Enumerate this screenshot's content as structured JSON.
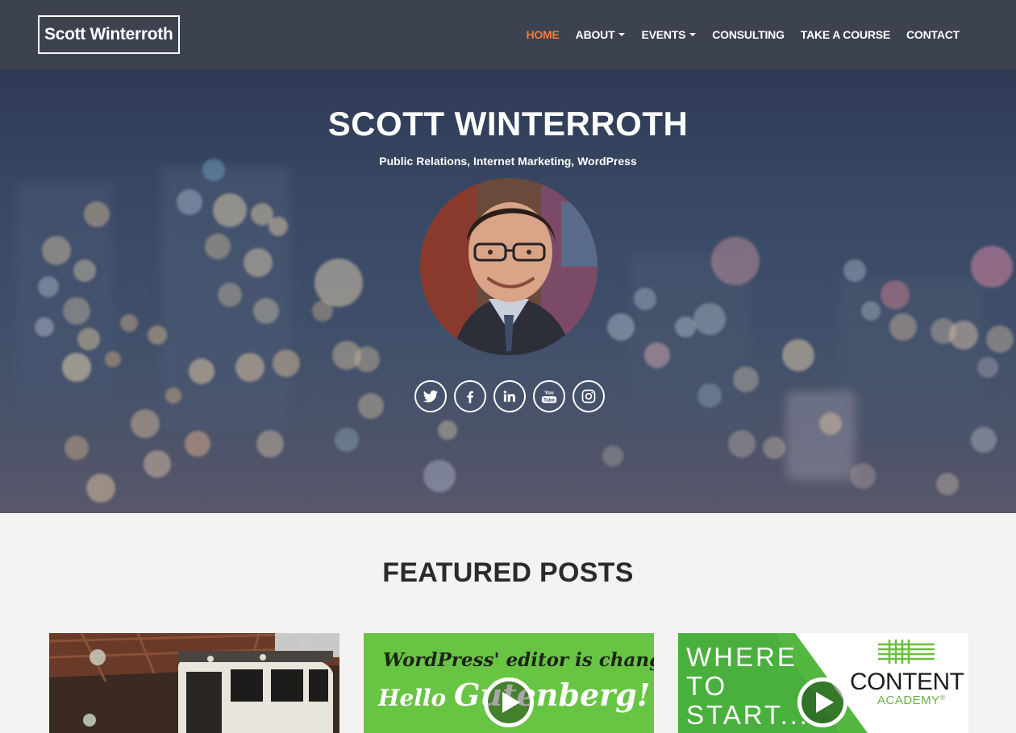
{
  "brand": "Scott Winterroth",
  "nav": [
    {
      "label": "HOME",
      "active": true,
      "dropdown": false
    },
    {
      "label": "ABOUT",
      "active": false,
      "dropdown": true
    },
    {
      "label": "EVENTS",
      "active": false,
      "dropdown": true
    },
    {
      "label": "CONSULTING",
      "active": false,
      "dropdown": false
    },
    {
      "label": "TAKE A COURSE",
      "active": false,
      "dropdown": false
    },
    {
      "label": "CONTACT",
      "active": false,
      "dropdown": false
    }
  ],
  "hero": {
    "title": "SCOTT WINTERROTH",
    "subtitle": "Public Relations, Internet Marketing, WordPress",
    "socials": [
      "twitter-icon",
      "facebook-icon",
      "linkedin-icon",
      "youtube-icon",
      "instagram-icon"
    ]
  },
  "featured": {
    "title": "FEATURED POSTS",
    "cards": [
      {
        "image": "train-photo"
      },
      {
        "image": "wordpress-gutenberg",
        "line1": "WordPress' editor is changing.",
        "line2_small": "Hello ",
        "line2_big": "Gutenberg!"
      },
      {
        "image": "content-academy",
        "lines": [
          "WHERE",
          "TO",
          "START..."
        ],
        "logo_title": "CONTENT",
        "logo_sub": "ACADEMY",
        "reg": "®"
      }
    ]
  },
  "colors": {
    "navbar": "#3c434f",
    "accent": "#f47c3c",
    "background": "#f4f3f1",
    "green": "#5cbf3a"
  }
}
